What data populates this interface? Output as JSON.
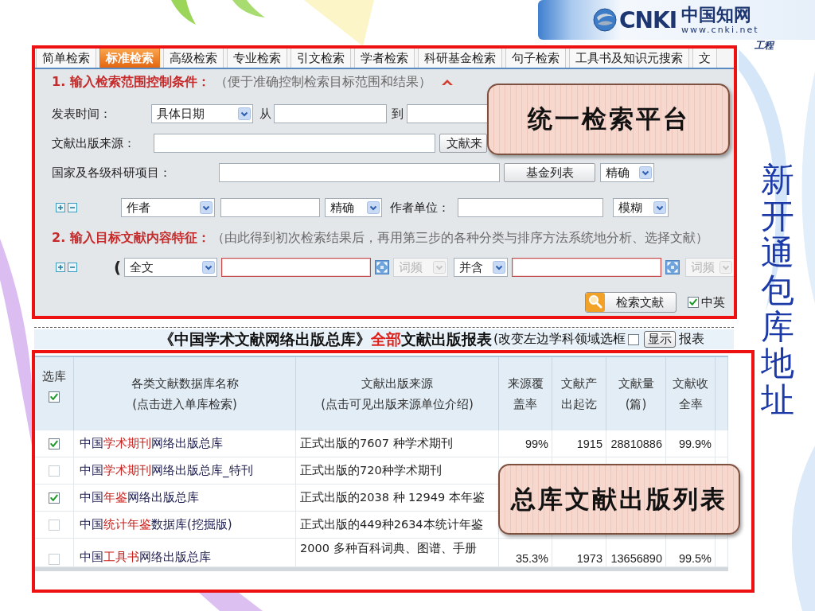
{
  "logo": {
    "mark": "CNKI",
    "name": "中国知网",
    "url": "www.cnki.net",
    "tagline": "工程"
  },
  "search_panel": {
    "tabs": [
      {
        "label": "简单检索",
        "selected": false
      },
      {
        "label": "标准检索",
        "selected": true
      },
      {
        "label": "高级检索",
        "selected": false
      },
      {
        "label": "专业检索",
        "selected": false
      },
      {
        "label": "引文检索",
        "selected": false
      },
      {
        "label": "学者检索",
        "selected": false
      },
      {
        "label": "科研基金检索",
        "selected": false
      },
      {
        "label": "句子检索",
        "selected": false
      },
      {
        "label": "工具书及知识元搜索",
        "selected": false
      },
      {
        "label": "文",
        "selected": false
      }
    ],
    "section_1": {
      "heading": "1. 输入检索范围控制条件：",
      "hint": "（便于准确控制检索目标范围和结果）",
      "expanded": true
    },
    "date": {
      "label": "发表时间：",
      "mode": "具体日期",
      "from_label": "从",
      "to_label": "到"
    },
    "source": {
      "label": "文献出版来源：",
      "button": "文献来"
    },
    "fund": {
      "label": "国家及各级科研项目：",
      "button": "基金列表",
      "match": "精确"
    },
    "author": {
      "field": "作者",
      "match": "精确",
      "unit_label": "作者单位：",
      "unit_match": "模糊"
    },
    "section_2": {
      "heading": "2. 输入目标文献内容特征：",
      "hint": "（由此得到初次检索结果后，再用第三步的各种分类与排序方法系统地分析、选择文献）"
    },
    "content": {
      "bracket": "(",
      "field": "全文",
      "terms": [
        {
          "frequency": "词频",
          "disabled": true
        },
        {
          "frequency": "词频",
          "disabled": true
        }
      ],
      "relation": "并含"
    },
    "submit": {
      "button": "检索文献",
      "bilingual_label": "中英",
      "bilingual_checked": true
    }
  },
  "report": {
    "title_before": "《中国学术文献网络出版总库》",
    "title_scope": "全部",
    "title_after": "文献出版报表",
    "note": "(改变左边学科领域选框",
    "note_checked": false,
    "show_button": "显示",
    "tail": "报表"
  },
  "table": {
    "columns": [
      {
        "label": "选库",
        "checked": true
      },
      {
        "label": "各类文献数据库名称",
        "note": "(点击进入单库检索)"
      },
      {
        "label": "文献出版来源",
        "note": "(点击可见出版来源单位介绍)"
      },
      {
        "label": "来源覆盖率"
      },
      {
        "label": "文献产出起讫"
      },
      {
        "label": "文献量(篇)"
      },
      {
        "label": "文献收全率"
      }
    ],
    "rows": [
      {
        "checked": true,
        "name": {
          "before": "中国",
          "highlight": "学术期刊",
          "after": "网络出版总库"
        },
        "source": "正式出版的7607 种学术期刊",
        "coverage": "99%",
        "since": "1915",
        "count": "28810886",
        "completeness": "99.9%"
      },
      {
        "checked": false,
        "name": {
          "before": "中国",
          "highlight": "学术期刊",
          "after": "网络出版总库_特刊"
        },
        "source": "正式出版的720种学术期刊"
      },
      {
        "checked": true,
        "name": {
          "before": "中国",
          "highlight": "年鉴",
          "after": "网络出版总库"
        },
        "source": "正式出版的2038 种 12949 本年鉴"
      },
      {
        "checked": false,
        "name": {
          "before": "中国",
          "highlight": "统计年鉴",
          "after": "数据库(挖掘版)"
        },
        "source": "正式出版的449种2634本统计年鉴"
      },
      {
        "checked": false,
        "name": {
          "before": "中国",
          "highlight": "工具书",
          "after": "网络出版总库"
        },
        "source": "2000 多种百科词典、图谱、手册",
        "coverage": "35.3%",
        "since": "1973",
        "count": "13656890",
        "completeness": "99.5%"
      }
    ]
  },
  "callouts": [
    {
      "text": "统一检索平台"
    },
    {
      "text": "总库文献出版列表"
    }
  ],
  "side_title": "新开通包库地址"
}
